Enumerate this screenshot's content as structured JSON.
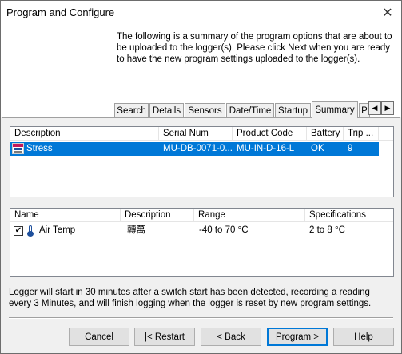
{
  "window": {
    "title": "Program and Configure",
    "close_glyph": "✕"
  },
  "intro": "The following is a summary of the program options that are about to be uploaded to the logger(s). Please click Next when you are ready to have the new program settings uploaded to the logger(s).",
  "tabs": [
    {
      "label": "Search"
    },
    {
      "label": "Details"
    },
    {
      "label": "Sensors"
    },
    {
      "label": "Date/Time"
    },
    {
      "label": "Startup"
    },
    {
      "label": "Summary",
      "active": true
    },
    {
      "label": "P"
    }
  ],
  "tab_scroll": {
    "left": "◀",
    "right": "▶"
  },
  "loggers": {
    "columns": [
      "Description",
      "Serial Num",
      "Product Code",
      "Battery",
      "Trip ..."
    ],
    "rows": [
      {
        "description": "Stress",
        "serial": "MU-DB-0071-0...",
        "product_code": "MU-IN-D-16-L",
        "battery": "OK",
        "trip": "9",
        "selected": true
      }
    ]
  },
  "sensors": {
    "columns": [
      "Name",
      "Description",
      "Range",
      "Specifications"
    ],
    "rows": [
      {
        "checked": "✔",
        "name": "Air Temp",
        "description": "轉萬",
        "range": "-40 to 70 °C",
        "specifications": "2 to 8 °C"
      }
    ]
  },
  "footer": "Logger will start in 30 minutes after a switch start has been detected, recording a reading every 3 Minutes, and will finish logging when the logger is reset by new program settings.",
  "buttons": {
    "cancel": "Cancel",
    "restart": "|< Restart",
    "back": "< Back",
    "program": "Program >",
    "help": "Help"
  }
}
